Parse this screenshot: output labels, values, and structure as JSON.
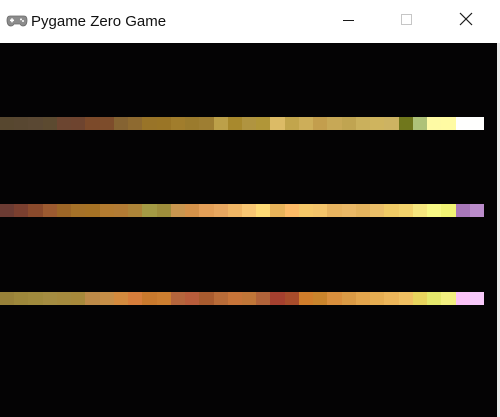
{
  "window": {
    "title": "Pygame Zero Game",
    "icon": "gamepad-icon",
    "controls": {
      "minimize": "minimize-icon",
      "maximize": "maximize-icon",
      "close": "close-icon"
    }
  },
  "game": {
    "background_color": "#040304",
    "bars": [
      {
        "colors": [
          "#57472f",
          "#584731",
          "#5a4833",
          "#5c4a30",
          "#6c4530",
          "#6e442f",
          "#7c4a2a",
          "#7d4c2b",
          "#856332",
          "#8e6a30",
          "#997428",
          "#9a7526",
          "#a17d2c",
          "#9b7b2d",
          "#9e7e32",
          "#bca049",
          "#a8892d",
          "#b09440",
          "#b19638",
          "#dcbb66",
          "#c2a54c",
          "#cdae59",
          "#c39e4d",
          "#c7a856",
          "#c0a451",
          "#cab05c",
          "#cfb45e",
          "#cdb362",
          "#70771c",
          "#aec278",
          "#fefaa4",
          "#fffba3",
          "#fffffe",
          "#fffffe"
        ]
      },
      {
        "colors": [
          "#6b3b33",
          "#7a3f2f",
          "#8a4a2c",
          "#9c5a30",
          "#9d6627",
          "#a57128",
          "#a67225",
          "#b37b30",
          "#b27b34",
          "#ad8438",
          "#a49a44",
          "#9f8e3c",
          "#c9964f",
          "#d4924a",
          "#e39f58",
          "#e8a760",
          "#f0b665",
          "#f8c673",
          "#feda75",
          "#e8b35a",
          "#fdbb67",
          "#f6c869",
          "#f4c46a",
          "#e8b460",
          "#eab866",
          "#e4b35e",
          "#ebbf69",
          "#f0cb66",
          "#f3d36c",
          "#f6e67e",
          "#f8f885",
          "#f1f374",
          "#a877b9",
          "#bb8ccb"
        ]
      },
      {
        "colors": [
          "#988139",
          "#9d873b",
          "#a08a3d",
          "#a48c41",
          "#a58a3e",
          "#a7893b",
          "#bd8a48",
          "#c68e47",
          "#d38a3e",
          "#d77d3b",
          "#c9792d",
          "#cd7e30",
          "#b5653c",
          "#b85c3b",
          "#a85b2f",
          "#b86b38",
          "#c77439",
          "#c07638",
          "#b1633a",
          "#a5402f",
          "#a84c2b",
          "#d07d2b",
          "#c9842c",
          "#d98f3d",
          "#da9a45",
          "#e3a54d",
          "#e6ad52",
          "#ecb55a",
          "#f0c062",
          "#e8d45e",
          "#e5e86c",
          "#f2ef80",
          "#fbc2f7",
          "#f7c9fa"
        ]
      }
    ]
  }
}
